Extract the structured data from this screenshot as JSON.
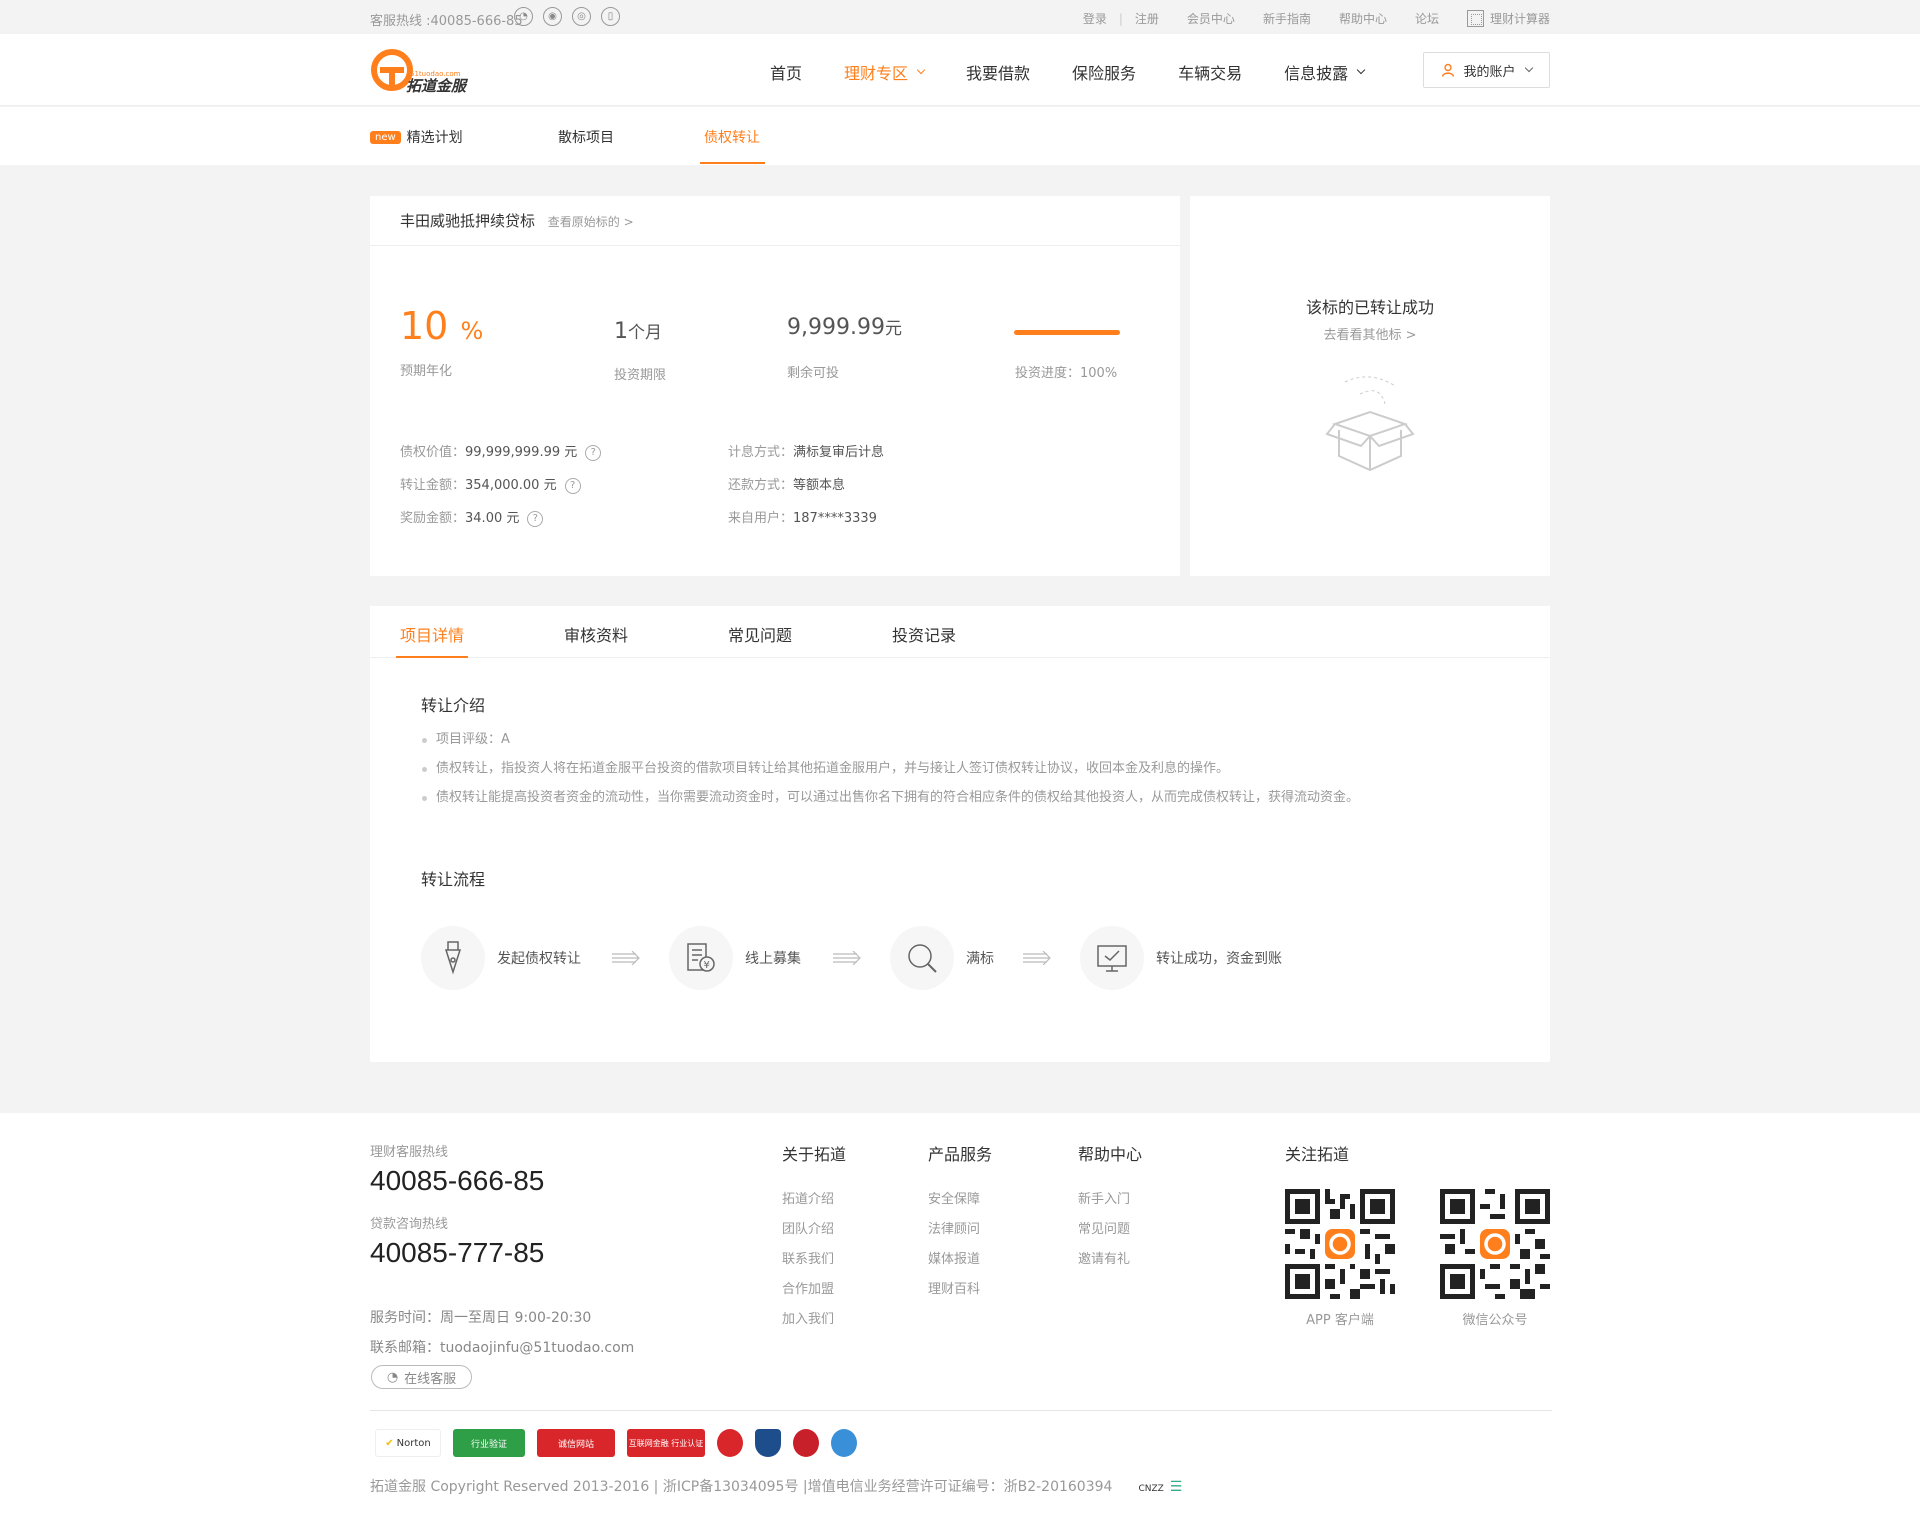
{
  "topbar": {
    "hotline": "客服热线 :40085-666-85",
    "links": [
      "登录",
      "注册",
      "会员中心",
      "新手指南",
      "帮助中心",
      "论坛"
    ],
    "calc": "理财计算器"
  },
  "header": {
    "nav": [
      "首页",
      "理财专区",
      "我要借款",
      "保险服务",
      "车辆交易",
      "信息披露"
    ],
    "account": "我的账户"
  },
  "subnav": {
    "badge": "new",
    "items": [
      "精选计划",
      "散标项目",
      "债权转让"
    ]
  },
  "loan": {
    "title": "丰田威驰抵押续贷标",
    "view_link": "查看原始标的",
    "rate": "10",
    "rate_unit": "%",
    "rate_label": "预期年化",
    "term": "1",
    "term_unit": "个月",
    "term_label": "投资期限",
    "remain": "9,999.99",
    "remain_unit": "元",
    "remain_label": "剩余可投",
    "progress_label": "投资进度：100%",
    "progress": 1.0,
    "left_details": [
      {
        "k": "债权价值：",
        "v": "99,999,999.99 元"
      },
      {
        "k": "转让金额：",
        "v": "354,000.00 元"
      },
      {
        "k": "奖励金额：",
        "v": "34.00 元"
      }
    ],
    "right_details": [
      {
        "k": "计息方式：",
        "v": "满标复审后计息"
      },
      {
        "k": "还款方式：",
        "v": "等额本息"
      },
      {
        "k": "来自用户：",
        "v": "187****3339"
      }
    ]
  },
  "status": {
    "title": "该标的已转让成功",
    "link": "去看看其他标 >"
  },
  "tabs": [
    "项目详情",
    "审核资料",
    "常见问题",
    "投资记录"
  ],
  "intro": {
    "title": "转让介绍",
    "bullets": [
      "项目评级：A",
      "债权转让，指投资人将在拓道金服平台投资的借款项目转让给其他拓道金服用户，并与接让人签订债权转让协议，收回本金及利息的操作。",
      "债权转让能提高投资者资金的流动性，当你需要流动资金时，可以通过出售你名下拥有的符合相应条件的债权给其他投资人，从而完成债权转让，获得流动资金。"
    ]
  },
  "flow": {
    "title": "转让流程",
    "steps": [
      "发起债权转让",
      "线上募集",
      "满标",
      "转让成功，资金到账"
    ]
  },
  "footer": {
    "hot1_label": "理财客服热线",
    "hot1": "40085-666-85",
    "hot2_label": "贷款咨询热线",
    "hot2": "40085-777-85",
    "service_time": "服务时间：周一至周日  9:00-20:30",
    "email": "联系邮箱：tuodaojinfu@51tuodao.com",
    "kefu": "在线客服",
    "cols": [
      {
        "title": "关于拓道",
        "links": [
          "拓道介绍",
          "团队介绍",
          "联系我们",
          "合作加盟",
          "加入我们"
        ]
      },
      {
        "title": "产品服务",
        "links": [
          "安全保障",
          "法律顾问",
          "媒体报道",
          "理财百科"
        ]
      },
      {
        "title": "帮助中心",
        "links": [
          "新手入门",
          "常见问题",
          "邀请有礼"
        ]
      }
    ],
    "follow_title": "关注拓道",
    "qr1": "APP 客户端",
    "qr2": "微信公众号",
    "certs": [
      "Norton",
      "行业验证",
      "诚信网站",
      "互联网金融 行业认证"
    ],
    "copyright": "拓道金服 Copyright Reserved 2013-2016 | 浙ICP备13034095号 |增值电信业务经营许可证编号：浙B2-20160394",
    "cnzz": "CNZZ"
  },
  "colors": {
    "accent": "#ff7f1c"
  }
}
